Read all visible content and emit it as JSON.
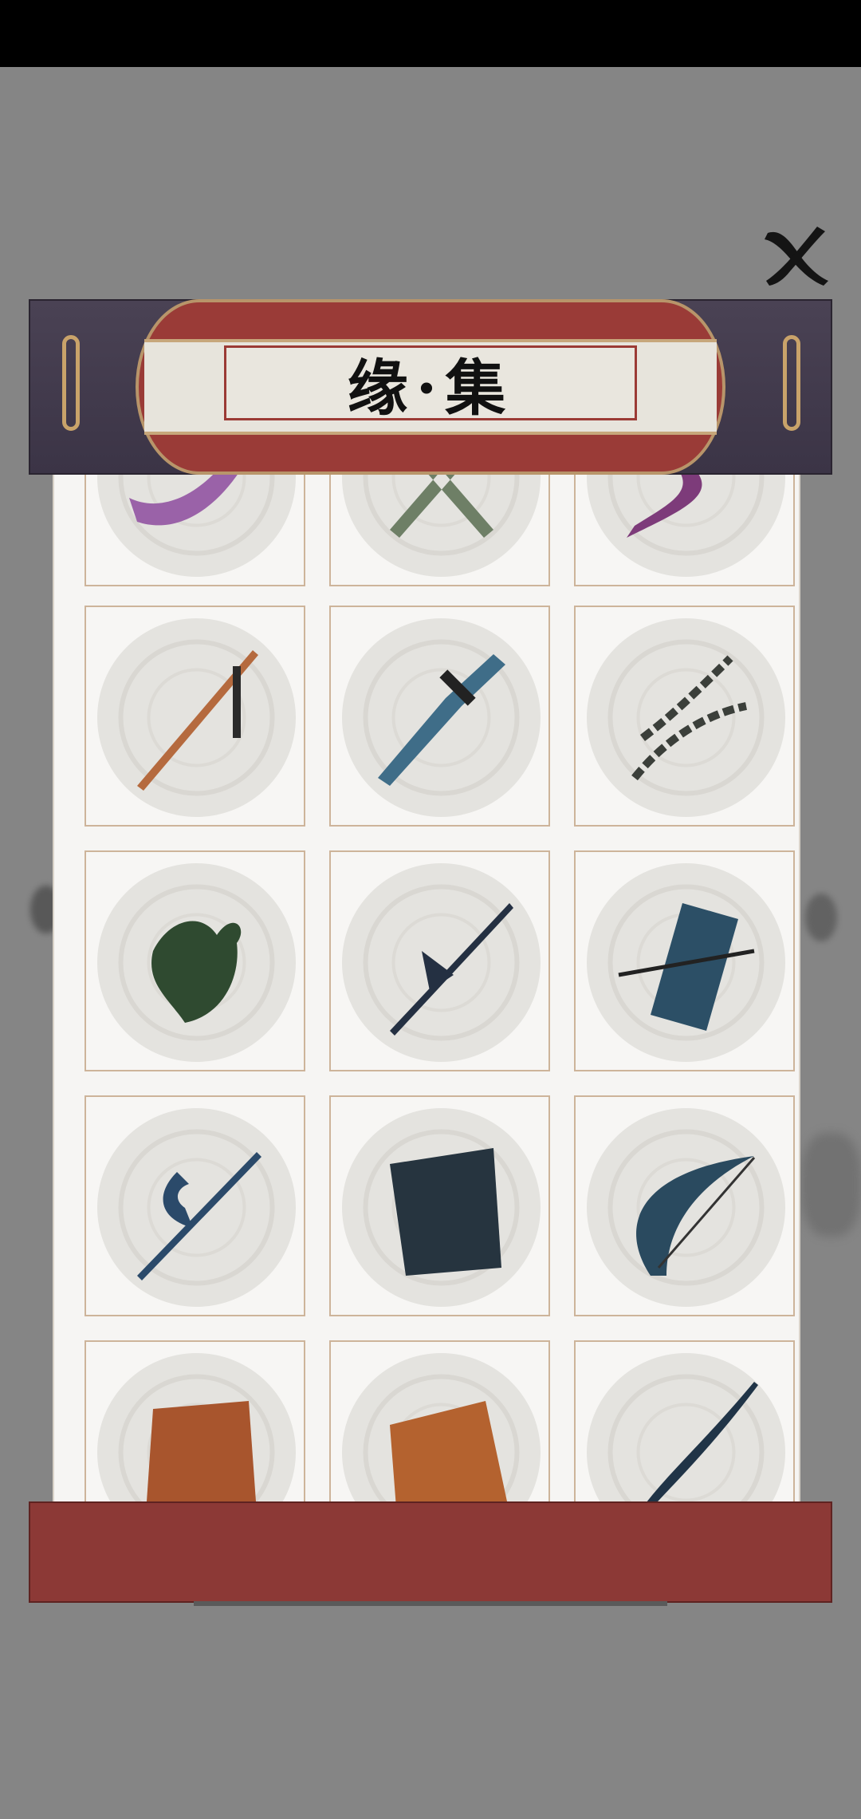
{
  "header": {
    "title": "缘·集"
  },
  "close_button": {
    "icon": "ink-x-icon"
  },
  "items": [
    {
      "name": "purple-broadsword-icon",
      "color": "#9a62a8"
    },
    {
      "name": "crossed-swords-icon",
      "color": "#6e7f66"
    },
    {
      "name": "purple-twisted-blade-icon",
      "color": "#7d3b7a"
    },
    {
      "name": "tasseled-sword-icon",
      "color": "#b56a3e"
    },
    {
      "name": "great-sword-icon",
      "color": "#3f6d88"
    },
    {
      "name": "chain-flail-icon",
      "color": "#3b3f3a"
    },
    {
      "name": "axe-head-icon",
      "color": "#2f4a30"
    },
    {
      "name": "halberd-spear-icon",
      "color": "#243042"
    },
    {
      "name": "scroll-with-spear-icon",
      "color": "#2c4f66"
    },
    {
      "name": "crescent-halberd-icon",
      "color": "#2b4a6a"
    },
    {
      "name": "armor-scroll-icon",
      "color": "#26343f"
    },
    {
      "name": "recurve-bow-icon",
      "color": "#2a4a5f"
    },
    {
      "name": "tassel-scroll-icon",
      "color": "#a8552d"
    },
    {
      "name": "torn-scroll-icon",
      "color": "#b4622f"
    },
    {
      "name": "serpent-spear-icon",
      "color": "#203447"
    }
  ]
}
